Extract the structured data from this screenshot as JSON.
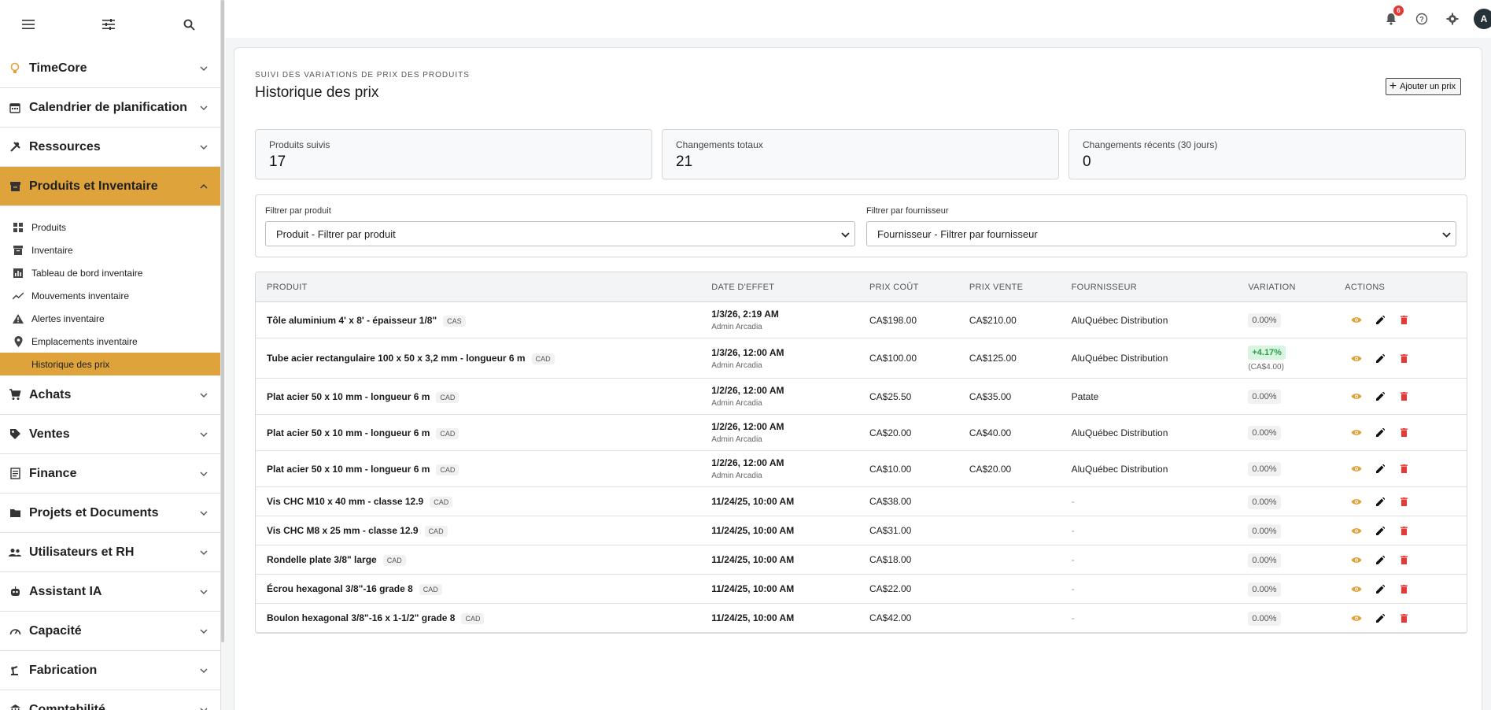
{
  "sidebar": {
    "nav": [
      {
        "label": "TimeCore",
        "icon": "lightbulb-icon"
      },
      {
        "label": "Calendrier de planification",
        "icon": "calendar-icon"
      },
      {
        "label": "Ressources",
        "icon": "tools-icon"
      },
      {
        "label": "Produits et Inventaire",
        "icon": "inventory-icon"
      },
      {
        "label": "Achats",
        "icon": "cart-icon"
      },
      {
        "label": "Ventes",
        "icon": "tag-icon"
      },
      {
        "label": "Finance",
        "icon": "receipt-icon"
      },
      {
        "label": "Projets et Documents",
        "icon": "folder-icon"
      },
      {
        "label": "Utilisateurs et RH",
        "icon": "people-icon"
      },
      {
        "label": "Assistant IA",
        "icon": "robot-icon"
      },
      {
        "label": "Capacité",
        "icon": "gauge-icon"
      },
      {
        "label": "Fabrication",
        "icon": "robot-arm-icon"
      },
      {
        "label": "Comptabilité",
        "icon": "bank-icon"
      }
    ],
    "sub": [
      {
        "label": "Produits",
        "icon": "grid-icon"
      },
      {
        "label": "Inventaire",
        "icon": "archive-icon"
      },
      {
        "label": "Tableau de bord inventaire",
        "icon": "bar-chart-icon"
      },
      {
        "label": "Mouvements inventaire",
        "icon": "trend-icon"
      },
      {
        "label": "Alertes inventaire",
        "icon": "warning-icon"
      },
      {
        "label": "Emplacements inventaire",
        "icon": "location-pin-icon"
      },
      {
        "label": "Historique des prix",
        "icon": "history-icon"
      }
    ]
  },
  "topbar": {
    "notifications_count": "6",
    "avatar_initial": "A"
  },
  "page": {
    "eyebrow": "SUIVI DES VARIATIONS DE PRIX DES PRODUITS",
    "title": "Historique des prix",
    "add_button": "Ajouter un prix"
  },
  "stats": [
    {
      "label": "Produits suivis",
      "value": "17"
    },
    {
      "label": "Changements totaux",
      "value": "21"
    },
    {
      "label": "Changements récents (30 jours)",
      "value": "0"
    }
  ],
  "filters": {
    "product": {
      "label": "Filtrer par produit",
      "value": "Produit - Filtrer par produit"
    },
    "supplier": {
      "label": "Filtrer par fournisseur",
      "value": "Fournisseur - Filtrer par fournisseur"
    }
  },
  "table": {
    "headers": [
      "PRODUIT",
      "DATE D'EFFET",
      "PRIX COÛT",
      "PRIX VENTE",
      "FOURNISSEUR",
      "VARIATION",
      "ACTIONS"
    ],
    "rows": [
      {
        "product": "Tôle aluminium 4' x 8' - épaisseur 1/8\"",
        "currency": "CAS",
        "date": "1/3/26, 2:19 AM",
        "by": "Admin Arcadia",
        "cost": "CA$198.00",
        "sale": "CA$210.00",
        "supplier": "AluQuébec Distribution",
        "variation": "0.00%",
        "variation_sub": ""
      },
      {
        "product": "Tube acier rectangulaire 100 x 50 x 3,2 mm - longueur 6 m",
        "currency": "CAD",
        "date": "1/3/26, 12:00 AM",
        "by": "Admin Arcadia",
        "cost": "CA$100.00",
        "sale": "CA$125.00",
        "supplier": "AluQuébec Distribution",
        "variation": "+4.17%",
        "variation_sub": "(CA$4.00)"
      },
      {
        "product": "Plat acier 50 x 10 mm - longueur 6 m",
        "currency": "CAD",
        "date": "1/2/26, 12:00 AM",
        "by": "Admin Arcadia",
        "cost": "CA$25.50",
        "sale": "CA$35.00",
        "supplier": "Patate",
        "variation": "0.00%",
        "variation_sub": ""
      },
      {
        "product": "Plat acier 50 x 10 mm - longueur 6 m",
        "currency": "CAD",
        "date": "1/2/26, 12:00 AM",
        "by": "Admin Arcadia",
        "cost": "CA$20.00",
        "sale": "CA$40.00",
        "supplier": "AluQuébec Distribution",
        "variation": "0.00%",
        "variation_sub": ""
      },
      {
        "product": "Plat acier 50 x 10 mm - longueur 6 m",
        "currency": "CAD",
        "date": "1/2/26, 12:00 AM",
        "by": "Admin Arcadia",
        "cost": "CA$10.00",
        "sale": "CA$20.00",
        "supplier": "AluQuébec Distribution",
        "variation": "0.00%",
        "variation_sub": ""
      },
      {
        "product": "Vis CHC M10 x 40 mm - classe 12.9",
        "currency": "CAD",
        "date": "11/24/25, 10:00 AM",
        "by": "",
        "cost": "CA$38.00",
        "sale": "",
        "supplier": "-",
        "variation": "0.00%",
        "variation_sub": ""
      },
      {
        "product": "Vis CHC M8 x 25 mm - classe 12.9",
        "currency": "CAD",
        "date": "11/24/25, 10:00 AM",
        "by": "",
        "cost": "CA$31.00",
        "sale": "",
        "supplier": "-",
        "variation": "0.00%",
        "variation_sub": ""
      },
      {
        "product": "Rondelle plate 3/8\" large",
        "currency": "CAD",
        "date": "11/24/25, 10:00 AM",
        "by": "",
        "cost": "CA$18.00",
        "sale": "",
        "supplier": "-",
        "variation": "0.00%",
        "variation_sub": ""
      },
      {
        "product": "Écrou hexagonal 3/8\"-16 grade 8",
        "currency": "CAD",
        "date": "11/24/25, 10:00 AM",
        "by": "",
        "cost": "CA$22.00",
        "sale": "",
        "supplier": "-",
        "variation": "0.00%",
        "variation_sub": ""
      },
      {
        "product": "Boulon hexagonal 3/8\"-16 x 1-1/2\" grade 8",
        "currency": "CAD",
        "date": "11/24/25, 10:00 AM",
        "by": "",
        "cost": "CA$42.00",
        "sale": "",
        "supplier": "-",
        "variation": "0.00%",
        "variation_sub": ""
      }
    ]
  },
  "colors": {
    "accent": "#dfa33b",
    "positive": "#2e9d4d",
    "delete": "#e53935",
    "view": "#dfa33b"
  }
}
